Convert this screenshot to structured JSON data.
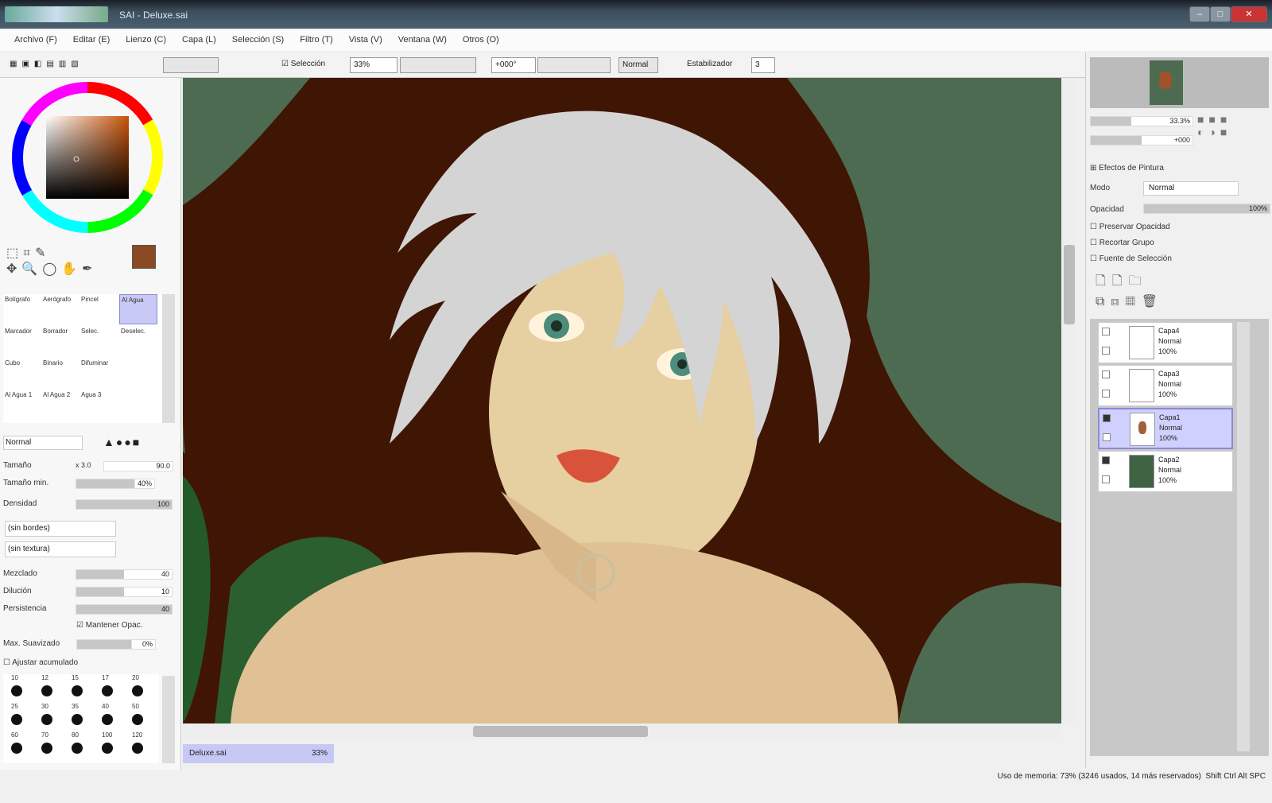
{
  "title": "SAI - Deluxe.sai",
  "menu": [
    "Archivo (F)",
    "Editar (E)",
    "Lienzo (C)",
    "Capa (L)",
    "Selección (S)",
    "Filtro (T)",
    "Vista (V)",
    "Ventana (W)",
    "Otros (O)"
  ],
  "toolbar": {
    "selection_label": "Selección",
    "zoom": "33%",
    "angle": "+000°",
    "mode": "Normal",
    "stabilizer_label": "Estabilizador",
    "stabilizer": "3"
  },
  "tools": [
    "Bolígrafo",
    "Aerógrafo",
    "Pincel",
    "Al Agua",
    "Marcador",
    "Borrador",
    "Selec.",
    "Deselec.",
    "Cubo",
    "Binario",
    "Difuminar",
    "Al Agua 1",
    "Al Agua 2",
    "Agua 3"
  ],
  "brush": {
    "blend_mode": "Normal",
    "size_label": "Tamaño",
    "size_mult": "x 3.0",
    "size": "90.0",
    "min_size_label": "Tamaño min.",
    "min_size": "40%",
    "density_label": "Densidad",
    "density": "100",
    "shape": "(sin bordes)",
    "texture": "(sin textura)",
    "blending_label": "Mezclado",
    "blending": "40",
    "dilution_label": "Dilución",
    "dilution": "10",
    "persistence_label": "Persistencia",
    "persistence": "40",
    "keep_opacity": "Mantener Opac.",
    "max_smooth_label": "Max. Suavizado",
    "max_smooth": "0%",
    "adjust_label": "Ajustar acumulado",
    "sizes": [
      "10",
      "12",
      "15",
      "17",
      "20",
      "25",
      "30",
      "35",
      "40",
      "50",
      "60",
      "70",
      "80",
      "100",
      "120"
    ]
  },
  "canvas_tab": {
    "name": "Deluxe.sai",
    "zoom": "33%"
  },
  "navigator": {
    "zoom": "33.3%",
    "angle": "+000"
  },
  "layer_panel": {
    "paint_effects": "Efectos de Pintura",
    "mode_label": "Modo",
    "mode": "Normal",
    "opacity_label": "Opacidad",
    "opacity": "100%",
    "preserve_opacity": "Preservar Opacidad",
    "clip_group": "Recortar Grupo",
    "selection_source": "Fuente de Selección"
  },
  "layers": [
    {
      "name": "Capa4",
      "mode": "Normal",
      "opacity": "100%"
    },
    {
      "name": "Capa3",
      "mode": "Normal",
      "opacity": "100%"
    },
    {
      "name": "Capa1",
      "mode": "Normal",
      "opacity": "100%"
    },
    {
      "name": "Capa2",
      "mode": "Normal",
      "opacity": "100%"
    }
  ],
  "status": {
    "memory": "Uso de memoria: 73% (3246 usados, 14 más reservados)",
    "keys": "Shift Ctrl Alt SPC"
  }
}
